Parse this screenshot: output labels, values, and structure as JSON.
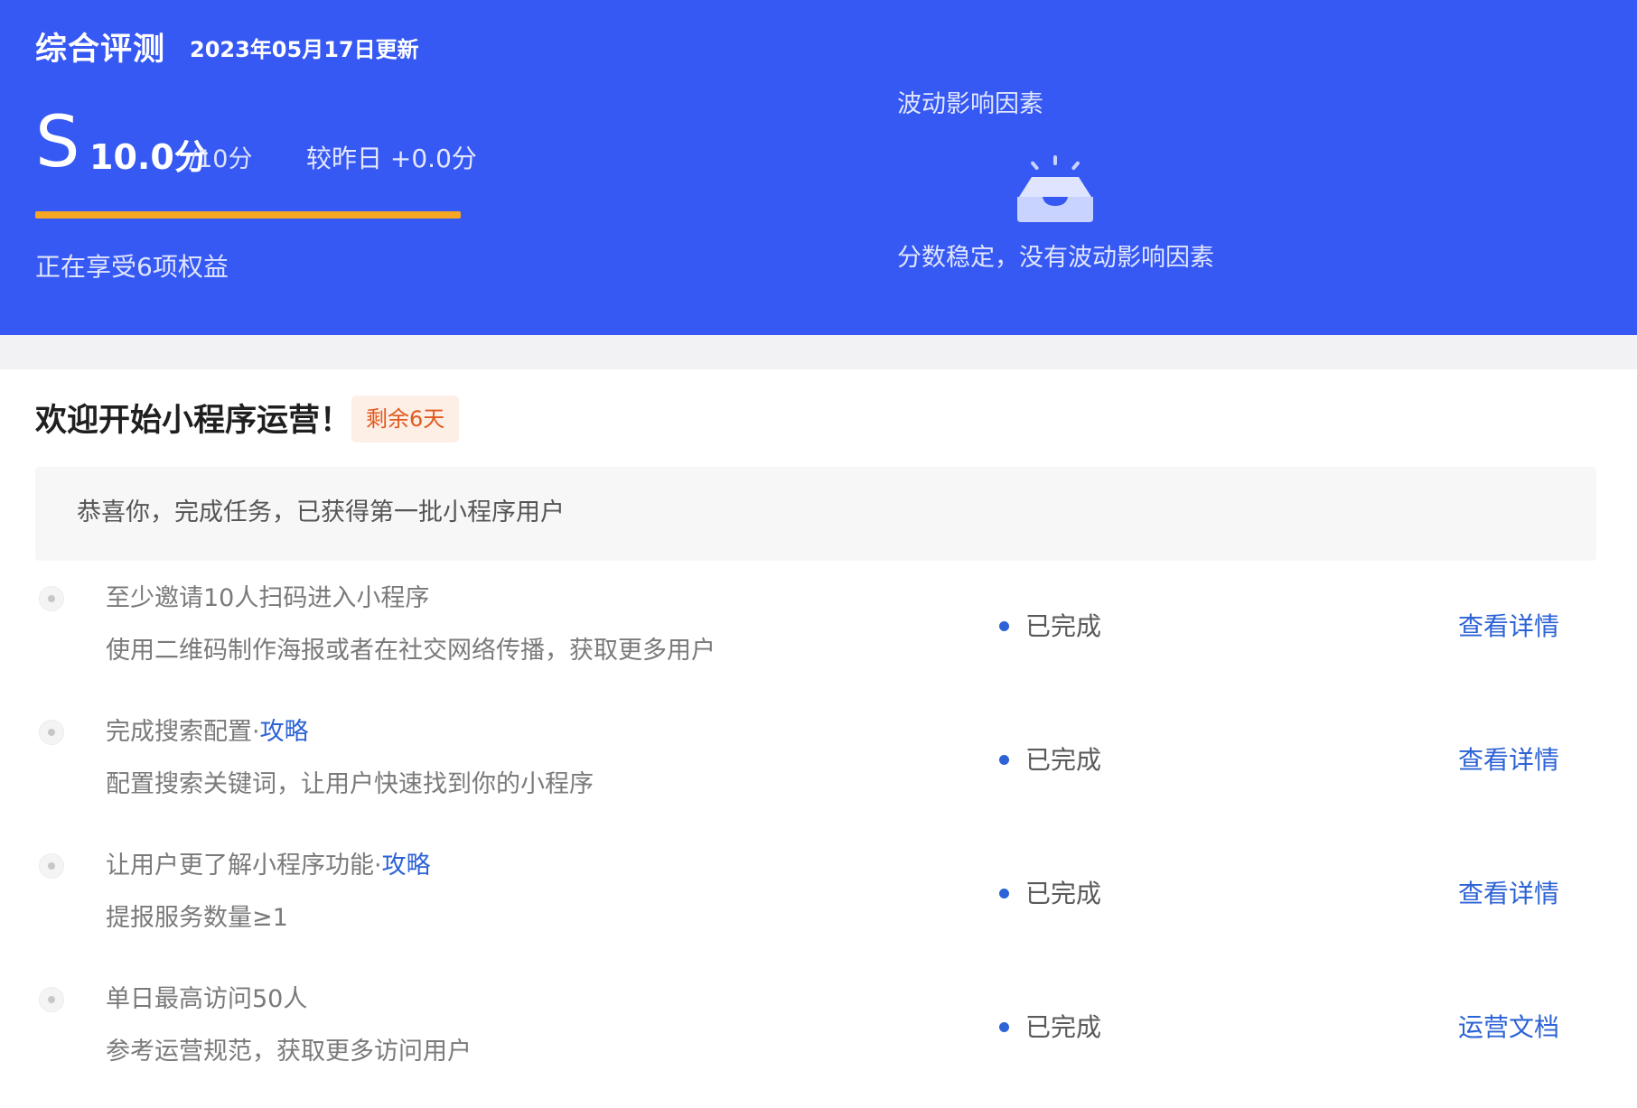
{
  "header": {
    "title": "综合评测",
    "updated": "2023年05月17日更新",
    "score": {
      "grade": "S",
      "value": "10.0分",
      "max": "/10分",
      "compare": "较昨日 +0.0分",
      "progress_fraction": 1.0
    },
    "benefits": "正在享受6项权益",
    "factors": {
      "title": "波动影响因素",
      "icon": "empty-inbox-icon",
      "empty_text": "分数稳定，没有波动影响因素"
    }
  },
  "section": {
    "title": "欢迎开始小程序运营！",
    "badge": "剩余6天",
    "congrats": "恭喜你，完成任务，已获得第一批小程序用户"
  },
  "tasks": [
    {
      "title": "至少邀请10人扫码进入小程序",
      "guide": "",
      "desc": "使用二维码制作海报或者在社交网络传播，获取更多用户",
      "status": "已完成",
      "action": "查看详情"
    },
    {
      "title": "完成搜索配置·",
      "guide": "攻略",
      "desc": "配置搜索关键词，让用户快速找到你的小程序",
      "status": "已完成",
      "action": "查看详情"
    },
    {
      "title": "让用户更了解小程序功能·",
      "guide": "攻略",
      "desc": "提报服务数量≥1",
      "status": "已完成",
      "action": "查看详情"
    },
    {
      "title": "单日最高访问50人",
      "guide": "",
      "desc": "参考运营规范，获取更多访问用户",
      "status": "已完成",
      "action": "运营文档"
    }
  ],
  "colors": {
    "header_bg": "#3658f3",
    "progress": "#f5a623",
    "link": "#2d63d6",
    "badge_text": "#e05a1e",
    "badge_bg": "#fdeee6"
  }
}
